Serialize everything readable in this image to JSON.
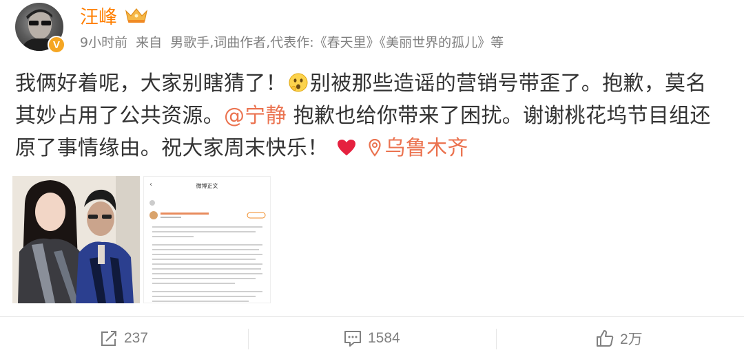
{
  "header": {
    "username": "汪峰",
    "time": "9小时前",
    "source": "来自",
    "bio": "男歌手,词曲作者,代表作:《春天里》《美丽世界的孤儿》等",
    "verified_mark": "V"
  },
  "post": {
    "text_1": "我俩好着呢，大家别瞎猜了！",
    "text_2": "别被那些造谣的营销号带歪了。抱歉，莫名其妙占用了公共资源。",
    "mention": "@宁静",
    "text_3": " 抱歉也给你带来了困扰。谢谢桃花坞节目组还原了事情缘由。祝大家周末快乐！",
    "location": "乌鲁木齐"
  },
  "screenshot_thumb": {
    "title": "微博正文",
    "back": "‹"
  },
  "actions": {
    "repost_count": "237",
    "comment_count": "1584",
    "like_count": "2万"
  },
  "colors": {
    "username": "#ff7f00",
    "link": "#eb7350",
    "meta": "#808080",
    "verified": "#f5a623"
  },
  "icons": [
    "crown-icon",
    "thinking-emoji-icon",
    "heart-icon",
    "location-pin-icon",
    "repost-icon",
    "comment-icon",
    "like-icon"
  ]
}
